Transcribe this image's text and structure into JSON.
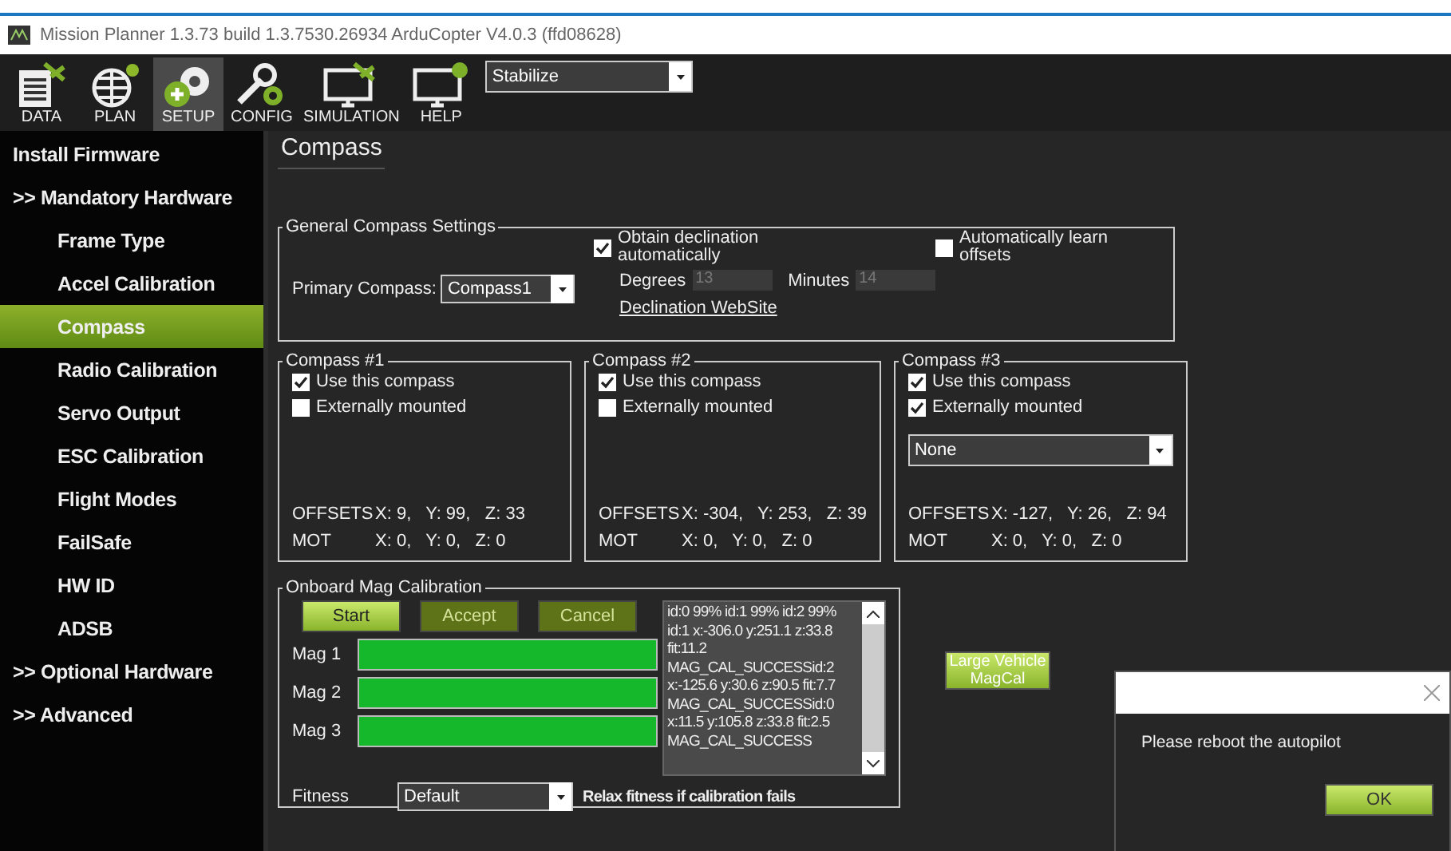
{
  "window": {
    "title": "Mission Planner 1.3.73 build 1.3.7530.26934 ArduCopter V4.0.3 (ffd08628)"
  },
  "toolbar": {
    "buttons": [
      {
        "kind": "data",
        "label": "DATA",
        "selected": false
      },
      {
        "kind": "plan",
        "label": "PLAN",
        "selected": false
      },
      {
        "kind": "setup",
        "label": "SETUP",
        "selected": true
      },
      {
        "kind": "config",
        "label": "CONFIG",
        "selected": false
      },
      {
        "kind": "simulation",
        "label": "SIMULATION",
        "selected": false
      },
      {
        "kind": "help",
        "label": "HELP",
        "selected": false
      }
    ],
    "mode_select": {
      "value": "Stabilize"
    }
  },
  "sidebar": {
    "items": [
      {
        "label": "Install Firmware",
        "selected": false
      },
      {
        "label": ">> Mandatory Hardware",
        "selected": false,
        "children": [
          {
            "label": "Frame Type",
            "selected": false
          },
          {
            "label": "Accel Calibration",
            "selected": false
          },
          {
            "label": "Compass",
            "selected": true
          },
          {
            "label": "Radio Calibration",
            "selected": false
          },
          {
            "label": "Servo Output",
            "selected": false
          },
          {
            "label": "ESC Calibration",
            "selected": false
          },
          {
            "label": "Flight Modes",
            "selected": false
          },
          {
            "label": "FailSafe",
            "selected": false
          },
          {
            "label": "HW ID",
            "selected": false
          },
          {
            "label": "ADSB",
            "selected": false
          }
        ]
      },
      {
        "label": ">> Optional Hardware",
        "selected": false
      },
      {
        "label": ">> Advanced",
        "selected": false
      }
    ]
  },
  "page": {
    "title": "Compass",
    "general": {
      "legend": "General Compass Settings",
      "primary_label": "Primary Compass:",
      "primary_value": "Compass1",
      "declination": {
        "label": "Obtain declination automatically",
        "checked": true
      },
      "degrees_label": "Degrees",
      "degrees_value": "13",
      "minutes_label": "Minutes",
      "minutes_value": "14",
      "link": "Declination WebSite",
      "learn": {
        "label": "Automatically learn offsets",
        "checked": false
      }
    },
    "compasses": [
      {
        "legend": "Compass #1",
        "use": {
          "label": "Use this compass",
          "checked": true
        },
        "external": {
          "label": "Externally mounted",
          "checked": false
        },
        "offsets_label": "OFFSETS",
        "offsets": "X: 9,   Y: 99,   Z: 33",
        "mot_label": "MOT",
        "mot": "X: 0,   Y: 0,   Z: 0"
      },
      {
        "legend": "Compass #2",
        "use": {
          "label": "Use this compass",
          "checked": true
        },
        "external": {
          "label": "Externally mounted",
          "checked": false
        },
        "offsets_label": "OFFSETS",
        "offsets": "X: -304,   Y: 253,   Z: 39",
        "mot_label": "MOT",
        "mot": "X: 0,   Y: 0,   Z: 0"
      },
      {
        "legend": "Compass #3",
        "use": {
          "label": "Use this compass",
          "checked": true
        },
        "external": {
          "label": "Externally mounted",
          "checked": true
        },
        "orientation": "None",
        "offsets_label": "OFFSETS",
        "offsets": "X: -127,   Y: 26,   Z: 94",
        "mot_label": "MOT",
        "mot": "X: 0,   Y: 0,   Z: 0"
      }
    ],
    "onboard": {
      "legend": "Onboard Mag Calibration",
      "buttons": [
        {
          "label": "Start",
          "disabled": false
        },
        {
          "label": "Accept",
          "disabled": true
        },
        {
          "label": "Cancel",
          "disabled": true
        }
      ],
      "mags": [
        {
          "label": "Mag 1",
          "level": 1
        },
        {
          "label": "Mag 2",
          "level": 1
        },
        {
          "label": "Mag 3",
          "level": 1
        }
      ],
      "log": [
        "id:0 99% id:1 99% id:2 99%",
        "id:1 x:-306.0 y:251.1 z:33.8",
        "fit:11.2",
        "MAG_CAL_SUCCESSid:2",
        "x:-125.6 y:30.6 z:90.5 fit:7.7",
        "MAG_CAL_SUCCESSid:0",
        "x:11.5 y:105.8 z:33.8 fit:2.5",
        "MAG_CAL_SUCCESS"
      ],
      "fitness_label": "Fitness",
      "fitness_value": "Default",
      "relax_note": "Relax fitness if calibration fails"
    },
    "large_vehicle_button": "Large Vehicle MagCal"
  },
  "dialog": {
    "message": "Please reboot the autopilot",
    "button": "OK"
  }
}
